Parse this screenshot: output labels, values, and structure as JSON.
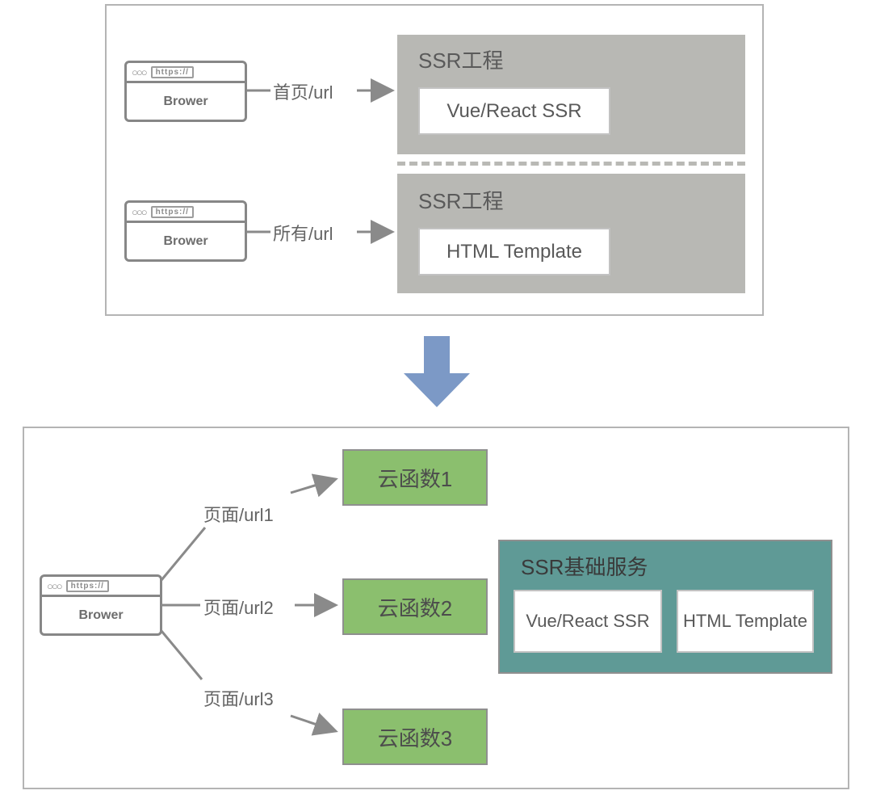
{
  "top": {
    "browser_label": "Brower",
    "addr_text": "https://",
    "arrow_labels": [
      "首页/url",
      "所有/url"
    ],
    "panels": [
      {
        "title": "SSR工程",
        "inner": "Vue/React SSR"
      },
      {
        "title": "SSR工程",
        "inner": "HTML Template"
      }
    ]
  },
  "bottom": {
    "browser_label": "Brower",
    "addr_text": "https://",
    "arrow_labels": [
      "页面/url1",
      "页面/url2",
      "页面/url3"
    ],
    "functions": [
      "云函数1",
      "云函数2",
      "云函数3"
    ],
    "service": {
      "title": "SSR基础服务",
      "inners": [
        "Vue/React SSR",
        "HTML Template"
      ]
    }
  }
}
